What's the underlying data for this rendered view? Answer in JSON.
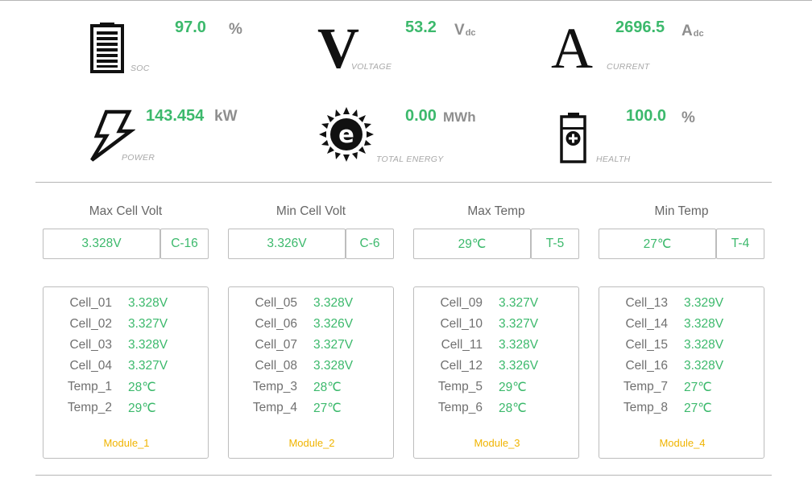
{
  "metrics": {
    "soc": {
      "value": "97.0",
      "unit": "%",
      "label": "SOC"
    },
    "voltage": {
      "value": "53.2",
      "unit": "V",
      "unit_sub": "dc",
      "label": "VOLTAGE",
      "icon_letter": "V"
    },
    "current": {
      "value": "2696.5",
      "unit": "A",
      "unit_sub": "dc",
      "label": "CURRENT",
      "icon_letter": "A"
    },
    "power": {
      "value": "143.454",
      "unit": "kW",
      "label": "POWER"
    },
    "total_energy": {
      "value": "0.00",
      "unit": "MWh",
      "label": "TOTAL ENERGY"
    },
    "health": {
      "value": "100.0",
      "unit": "%",
      "label": "HEALTH"
    }
  },
  "stats": [
    {
      "title": "Max Cell Volt",
      "value": "3.328V",
      "id": "C-16"
    },
    {
      "title": "Min Cell Volt",
      "value": "3.326V",
      "id": "C-6"
    },
    {
      "title": "Max Temp",
      "value": "29℃",
      "id": "T-5"
    },
    {
      "title": "Min Temp",
      "value": "27℃",
      "id": "T-4"
    }
  ],
  "modules": [
    {
      "name": "Module_1",
      "rows": [
        {
          "label": "Cell_01",
          "value": "3.328V"
        },
        {
          "label": "Cell_02",
          "value": "3.327V"
        },
        {
          "label": "Cell_03",
          "value": "3.328V"
        },
        {
          "label": "Cell_04",
          "value": "3.327V"
        },
        {
          "label": "Temp_1",
          "value": "28℃"
        },
        {
          "label": "Temp_2",
          "value": "29℃"
        }
      ]
    },
    {
      "name": "Module_2",
      "rows": [
        {
          "label": "Cell_05",
          "value": "3.328V"
        },
        {
          "label": "Cell_06",
          "value": "3.326V"
        },
        {
          "label": "Cell_07",
          "value": "3.327V"
        },
        {
          "label": "Cell_08",
          "value": "3.328V"
        },
        {
          "label": "Temp_3",
          "value": "28℃"
        },
        {
          "label": "Temp_4",
          "value": "27℃"
        }
      ]
    },
    {
      "name": "Module_3",
      "rows": [
        {
          "label": "Cell_09",
          "value": "3.327V"
        },
        {
          "label": "Cell_10",
          "value": "3.327V"
        },
        {
          "label": "Cell_11",
          "value": "3.328V"
        },
        {
          "label": "Cell_12",
          "value": "3.326V"
        },
        {
          "label": "Temp_5",
          "value": "29℃"
        },
        {
          "label": "Temp_6",
          "value": "28℃"
        }
      ]
    },
    {
      "name": "Module_4",
      "rows": [
        {
          "label": "Cell_13",
          "value": "3.329V"
        },
        {
          "label": "Cell_14",
          "value": "3.328V"
        },
        {
          "label": "Cell_15",
          "value": "3.328V"
        },
        {
          "label": "Cell_16",
          "value": "3.328V"
        },
        {
          "label": "Temp_7",
          "value": "27℃"
        },
        {
          "label": "Temp_8",
          "value": "27℃"
        }
      ]
    }
  ],
  "colors": {
    "value_green": "#3cb96c",
    "module_yellow": "#f0b400",
    "unit_gray": "#8e8e8e"
  },
  "icons": {
    "soc": "battery-level-icon",
    "voltage": "voltage-letter-icon",
    "current": "current-letter-icon",
    "power": "lightning-bolt-icon",
    "total_energy": "energy-sun-icon",
    "health": "battery-plus-icon"
  }
}
